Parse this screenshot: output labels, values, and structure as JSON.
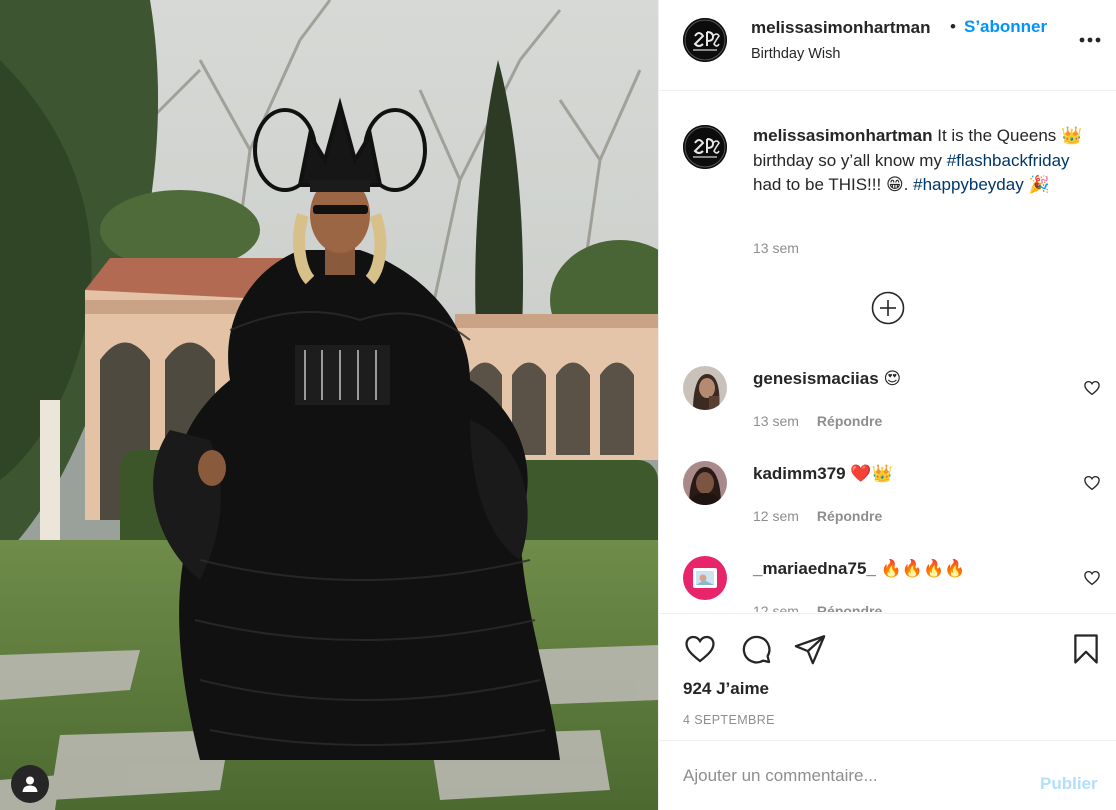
{
  "post": {
    "author": {
      "username": "melissasimonhartman",
      "follow_label": "S’abonner",
      "separator": "•",
      "location": "Birthday Wish"
    },
    "caption": {
      "username": "melissasimonhartman",
      "text_1": " It is the Queens ",
      "emoji_1": "👑",
      "text_2": " birthday so y’all know my ",
      "hashtag_1": "#flashbackfriday",
      "text_3": " had to be THIS!!! ",
      "emoji_2": "😁",
      "text_4": ". ",
      "hashtag_2": "#happybeyday",
      "text_5": " ",
      "emoji_3": "🎉",
      "time": "13 sem"
    },
    "comments": [
      {
        "username": "genesismaciias",
        "text": "😍",
        "time": "13 sem",
        "reply_label": "Répondre"
      },
      {
        "username": "kadimm379",
        "text": "❤️👑",
        "time": "12 sem",
        "reply_label": "Répondre"
      },
      {
        "username": "_mariaedna75_",
        "text": "🔥🔥🔥🔥",
        "time": "12 sem",
        "reply_label": "Répondre"
      }
    ],
    "likes": "924 J’aime",
    "date": "4 SEPTEMBRE",
    "add_comment": {
      "placeholder": "Ajouter un commentaire...",
      "publish_label": "Publier"
    }
  },
  "icons": {
    "more": "more-options-icon",
    "load_more": "plus-circle-icon",
    "like": "heart-icon",
    "comment": "comment-icon",
    "share": "share-icon",
    "save": "bookmark-icon",
    "user_tag": "user-icon"
  },
  "colors": {
    "accent": "#0095f6",
    "hashtag": "#00376b",
    "muted": "#8e8e8e",
    "text": "#262626",
    "publish_disabled": "#b2dffc"
  }
}
